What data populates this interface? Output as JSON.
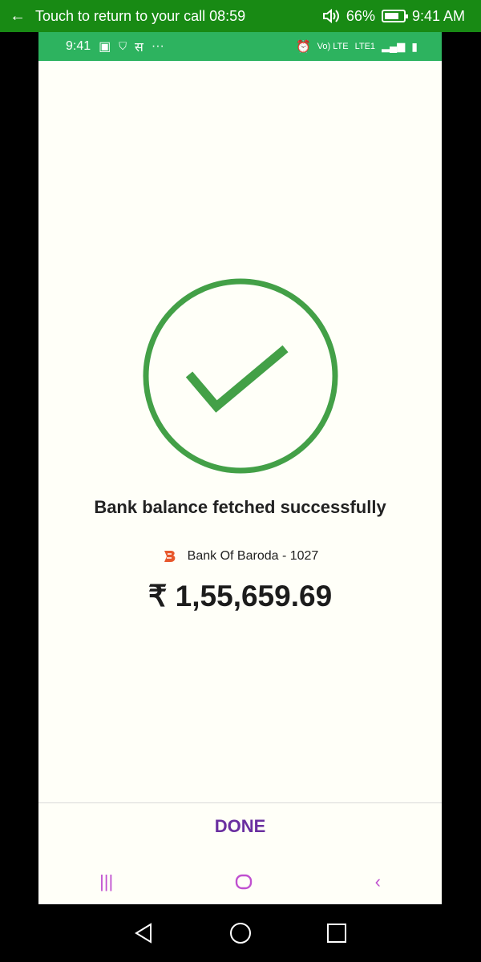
{
  "call_bar": {
    "text": "Touch to return to your call",
    "timer": "08:59",
    "battery": "66%",
    "battery_level": 0.66,
    "time": "9:41 AM"
  },
  "inner_status": {
    "time": "9:41",
    "lang_char": "स",
    "dots": "···",
    "network": "Vo) LTE",
    "network_sub": "LTE1"
  },
  "main": {
    "title": "Bank balance fetched successfully",
    "bank_name": "Bank Of Baroda - 1027",
    "amount": "₹ 1,55,659.69"
  },
  "footer": {
    "done_label": "DONE"
  },
  "colors": {
    "call_bar": "#188a14",
    "status_bar": "#2db35f",
    "check": "#43a047",
    "done": "#6a2fa0",
    "bank_logo": "#e8582c"
  }
}
